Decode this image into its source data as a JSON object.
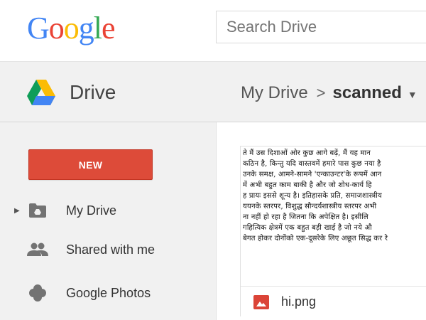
{
  "header": {
    "logo_text": "Google",
    "logo_colors": [
      "#4285f4",
      "#ea4335",
      "#fbbc05",
      "#4285f4",
      "#34a853",
      "#ea4335"
    ],
    "search": {
      "placeholder": "Search Drive",
      "value": ""
    }
  },
  "drivebar": {
    "app_name": "Drive",
    "breadcrumb": {
      "root": "My Drive",
      "separator": ">",
      "current": "scanned",
      "caret": "▼"
    }
  },
  "sidebar": {
    "new_button_label": "NEW",
    "new_button_color": "#dd4b39",
    "items": [
      {
        "label": "My Drive",
        "icon": "drive-folder-icon",
        "expandable": true
      },
      {
        "label": "Shared with me",
        "icon": "people-icon"
      },
      {
        "label": "Google Photos",
        "icon": "pinwheel-icon"
      }
    ]
  },
  "main": {
    "files": [
      {
        "name": "hi.png",
        "type_icon": "image-file-icon",
        "type_color": "#db4437",
        "preview_lines": [
          "ते मैं उस दिशाओं ओर कुछ आगे बढ़ें,  मैं यह मान",
          "कठिन है, किन्तु यदि वास्तवमें हमारे पास कुछ नया है",
          "उनके समक्ष, आमने-सामने 'एन्काउन्टर'के रूपमें आन",
          "में अभी बहुत काम बाकी है और जो शोध-कार्य हि",
          "ह प्रायः इससे शून्य है। इतिहासके प्रति, समाजशास्त्रीय",
          "ययनके स्तरपर, विशुद्ध सौन्दर्यशास्त्रीय स्तरपर अभी",
          "ना नहीं हो रहा है जितना कि अपेक्षित है। इसीलि",
          "गहित्यिक क्षेत्रमें एक बहुत बड़ी खाई है जो नये औ",
          "बेगत होकर दोनोंको एक-दूसरेके लिए अछूत सिद्ध कर रे"
        ]
      }
    ]
  }
}
